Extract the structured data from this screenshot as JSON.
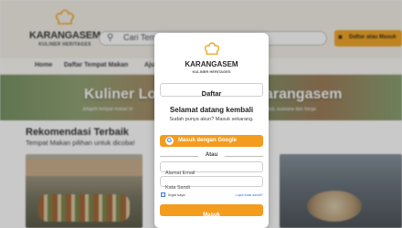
{
  "header": {
    "brand": "KARANGASEM",
    "brand_sub": "KULINER HERITAGES",
    "search_placeholder": "Cari Tem",
    "cta_label": "Daftar atau Masuk"
  },
  "nav": {
    "items": [
      "Home",
      "Daftar Tempat Makan",
      "Aju"
    ]
  },
  "hero": {
    "title_left": "Kuliner Lok",
    "title_right": "arangasem",
    "subtitle_left": "Jelajahi tempat makan te",
    "subtitle_right": "lokal, suasana dan harga"
  },
  "recommend": {
    "title": "Rekomendasi Terbaik",
    "subtitle": "Tempat Makan pilihan untuk dicoba!"
  },
  "modal": {
    "brand": "KARANGASEM",
    "brand_sub": "KULINER HERITAGES",
    "tab_label": "Daftar",
    "welcome": "Selamat datang kembali",
    "welcome_sub": "Sudah punya akun? Masuk sekarang.",
    "google_label": "Masuk dengan Google",
    "divider": "Atau",
    "email_placeholder": "Alamat Email",
    "password_placeholder": "Kata Sandi",
    "remember": "Ingat saya",
    "forgot": "Lupa kata sandi?",
    "submit": "Masuk"
  },
  "colors": {
    "accent": "#f39c1e",
    "header_bg": "#f3efe6"
  },
  "icons": {
    "logo": "chef-hat-icon",
    "search": "search-icon",
    "user": "user-icon",
    "google": "google-icon"
  }
}
